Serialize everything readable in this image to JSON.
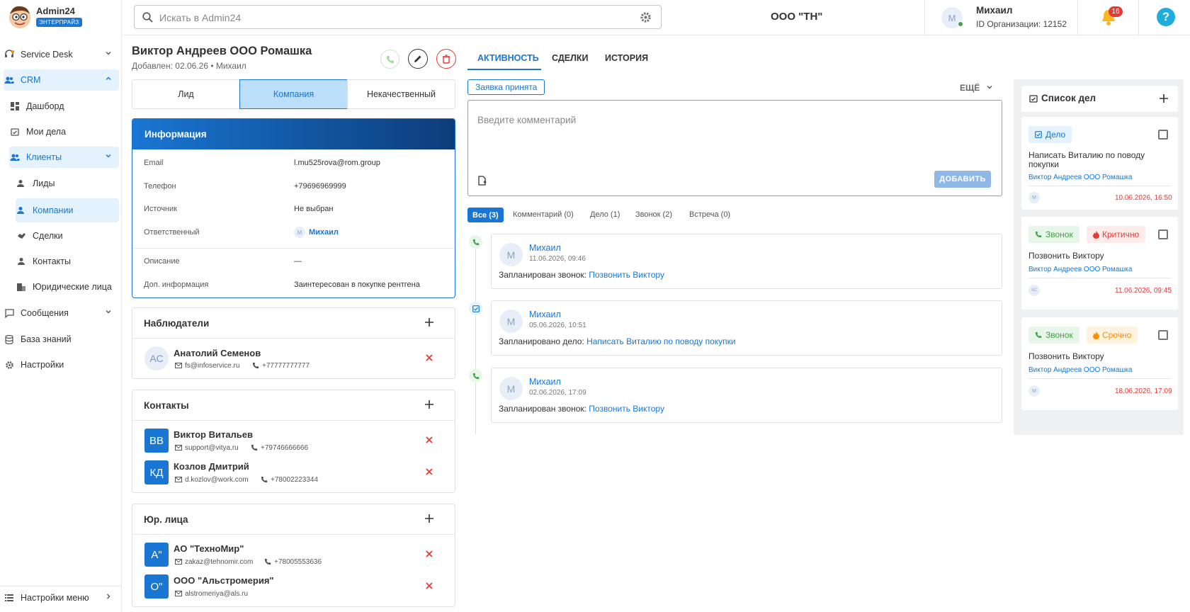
{
  "app": {
    "brand": "Admin24",
    "plan": "ЭНТЕРПРАЙЗ"
  },
  "search": {
    "placeholder": "Искать в Admin24"
  },
  "header": {
    "org": "ООО \"ТН\"",
    "user_initial": "М",
    "user_name": "Михаил",
    "org_id": "ID Организации: 12152",
    "notif_count": "16"
  },
  "sidebar": {
    "items": [
      {
        "label": "Service Desk"
      },
      {
        "label": "CRM"
      },
      {
        "label": "Дашборд"
      },
      {
        "label": "Мои дела"
      },
      {
        "label": "Клиенты"
      },
      {
        "label": "Лиды"
      },
      {
        "label": "Компании"
      },
      {
        "label": "Сделки"
      },
      {
        "label": "Контакты"
      },
      {
        "label": "Юридические лица"
      },
      {
        "label": "Сообщения"
      },
      {
        "label": "База знаний"
      },
      {
        "label": "Настройки"
      }
    ],
    "menu_settings": "Настройки меню"
  },
  "record": {
    "title": "Виктор Андреев ООО Ромашка",
    "subtitle": "Добавлен: 02.06.26 • Михаил"
  },
  "segments": [
    "Лид",
    "Компания",
    "Некачественный"
  ],
  "info": {
    "title": "Информация",
    "rows": [
      {
        "label": "Email",
        "value": "l.mu525rova@rom.group"
      },
      {
        "label": "Телефон",
        "value": "+79696969999"
      },
      {
        "label": "Источник",
        "value": "Не выбран"
      },
      {
        "label": "Ответственный",
        "value": "Михаил",
        "initial": "М"
      },
      {
        "label": "Описание",
        "value": "—"
      },
      {
        "label": "Доп. информация",
        "value": "Заинтересован в покупке рентгена"
      }
    ]
  },
  "observers": {
    "title": "Наблюдатели",
    "items": [
      {
        "initials": "АС",
        "name": "Анатолий Семенов",
        "email": "fs@infoservice.ru",
        "phone": "+77777777777"
      }
    ]
  },
  "contacts": {
    "title": "Контакты",
    "items": [
      {
        "initials": "ВВ",
        "name": "Виктор Витальев",
        "email": "support@vitya.ru",
        "phone": "+79746666666"
      },
      {
        "initials": "КД",
        "name": "Козлов Дмитрий",
        "email": "d.kozlov@work.com",
        "phone": "+78002223344"
      }
    ]
  },
  "legal": {
    "title": "Юр. лица",
    "items": [
      {
        "initials": "А\"",
        "name": "АО \"ТехноМир\"",
        "email": "zakaz@tehnomir.com",
        "phone": "+78005553636"
      },
      {
        "initials": "О\"",
        "name": "ООО \"Альстромерия\"",
        "email": "alstromeriya@als.ru",
        "phone": ""
      }
    ]
  },
  "tabs": [
    "АКТИВНОСТЬ",
    "СДЕЛКИ",
    "ИСТОРИЯ"
  ],
  "activity": {
    "status": "Заявка принята",
    "more": "ЕЩЁ",
    "comment_placeholder": "Введите комментарий",
    "add_button": "ДОБАВИТЬ",
    "filters": [
      "Все (3)",
      "Комментарий (0)",
      "Дело (1)",
      "Звонок (2)",
      "Встреча (0)"
    ],
    "feed": [
      {
        "initial": "М",
        "author": "Михаил",
        "date": "11.06.2026, 09:46",
        "text": "Запланирован звонок:",
        "link": "Позвонить Виктору",
        "kind": "phone"
      },
      {
        "initial": "М",
        "author": "Михаил",
        "date": "05.06.2026, 10:51",
        "text": "Запланировано дело:",
        "link": "Написать Виталию по поводу покупки",
        "kind": "task"
      },
      {
        "initial": "М",
        "author": "Михаил",
        "date": "02.06.2026, 17:09",
        "text": "Запланирован звонок:",
        "link": "Позвонить Виктору",
        "kind": "phone"
      }
    ]
  },
  "todo": {
    "title": "Список дел",
    "items": [
      {
        "tag1": "Дело",
        "tag2": "",
        "title": "Написать Виталию по поводу покупки",
        "client": "Виктор Андреев ООО Ромашка",
        "avatar": "М",
        "due": "10.06.2026, 16:50"
      },
      {
        "tag1": "Звонок",
        "tag2": "Критично",
        "title": "Позвонить Виктору",
        "client": "Виктор Андреев ООО Ромашка",
        "avatar": "АС",
        "due": "11.06.2026, 09:45"
      },
      {
        "tag1": "Звонок",
        "tag2": "Срочно",
        "title": "Позвонить Виктору",
        "client": "Виктор Андреев ООО Ромашка",
        "avatar": "М",
        "due": "18.06.2026, 17:09"
      }
    ]
  },
  "colors": {
    "accent": "#1976d2",
    "danger": "#e53935",
    "success": "#43a047",
    "warning": "#fb8c00"
  }
}
